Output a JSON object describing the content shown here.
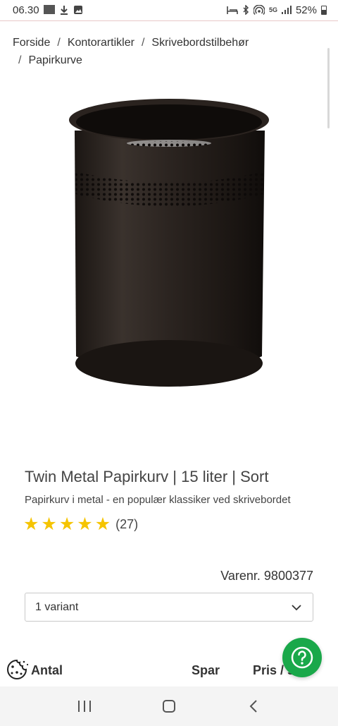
{
  "status_bar": {
    "time": "06.30",
    "network": "5G",
    "battery": "52%"
  },
  "breadcrumb": {
    "items": [
      "Forside",
      "Kontorartikler",
      "Skrivebordstilbehør",
      "Papirkurve"
    ],
    "separator": "/"
  },
  "product": {
    "title": "Twin Metal Papirkurv | 15 liter | Sort",
    "subtitle": "Papirkurv i metal - en populær klassiker ved skrivebordet",
    "rating_stars": 5,
    "review_count": "(27)",
    "item_number": "Varenr. 9800377",
    "variant_label": "1 variant",
    "image_icon": "wastebasket-image"
  },
  "table_header": {
    "quantity": "Antal",
    "save": "Spar",
    "price": "Pris / stk"
  },
  "colors": {
    "star": "#f5c400",
    "help_button": "#1aa84a"
  }
}
